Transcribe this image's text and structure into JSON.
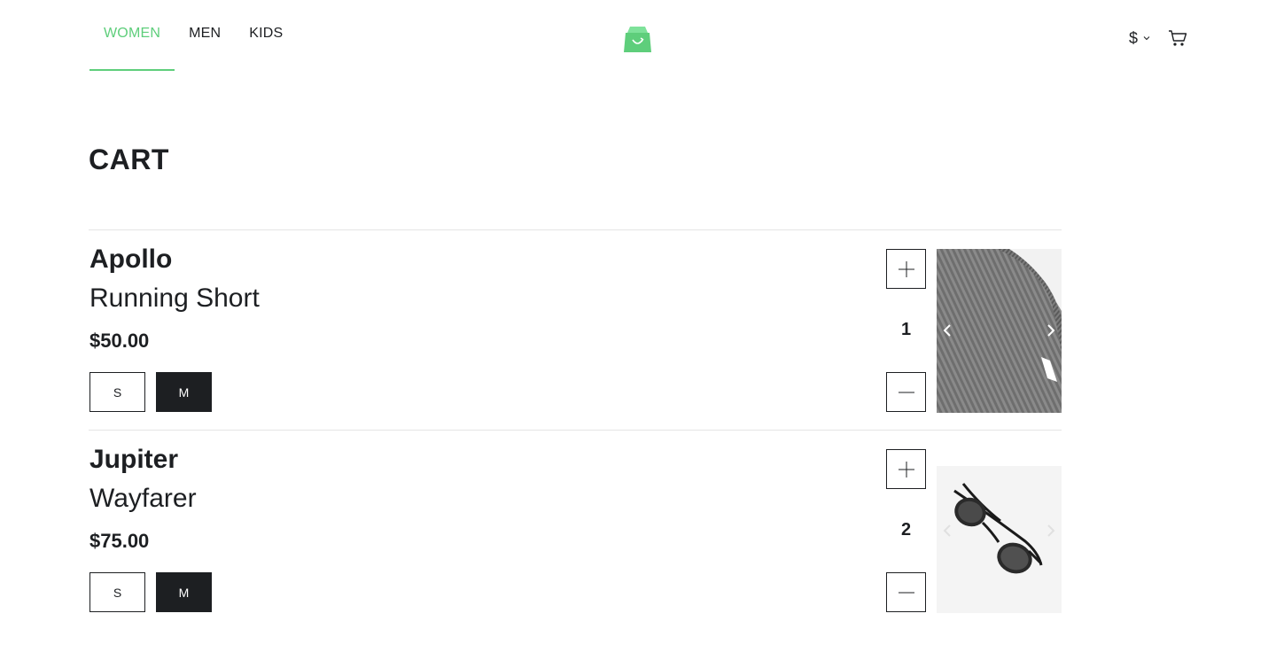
{
  "nav": {
    "tabs": [
      {
        "label": "WOMEN",
        "active": true
      },
      {
        "label": "MEN",
        "active": false
      },
      {
        "label": "KIDS",
        "active": false
      }
    ]
  },
  "header": {
    "logo_icon": "green-shopping-bag-icon",
    "currency_symbol": "$",
    "cart_icon": "cart-icon"
  },
  "colors": {
    "accent": "#5ece7b",
    "text": "#1d1f22",
    "selected_size_bg": "#1d1f22"
  },
  "page": {
    "title": "CART"
  },
  "cart": {
    "items": [
      {
        "brand": "Apollo",
        "name": "Running Short",
        "price": "$50.00",
        "sizes": [
          "S",
          "M"
        ],
        "selected_size": "M",
        "quantity": "1",
        "image": "grey-knit-sweater-photo"
      },
      {
        "brand": "Jupiter",
        "name": "Wayfarer",
        "price": "$75.00",
        "sizes": [
          "S",
          "M"
        ],
        "selected_size": "M",
        "quantity": "2",
        "image": "sunglasses-photo"
      }
    ]
  }
}
